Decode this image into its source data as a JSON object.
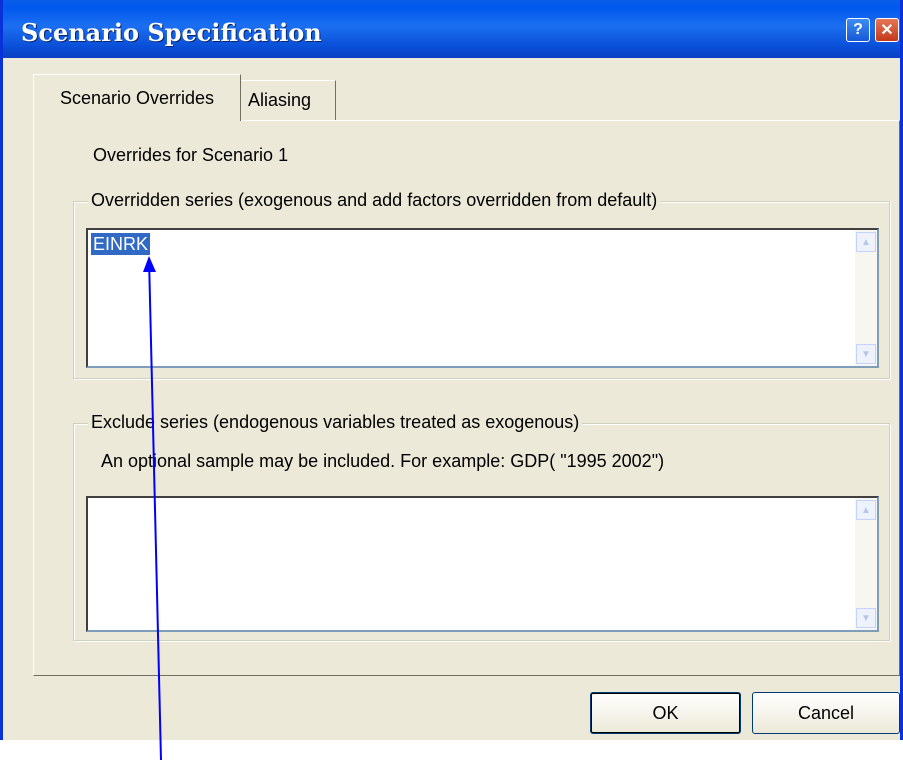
{
  "window": {
    "title": "Scenario Specification",
    "help_glyph": "?",
    "close_glyph": "✕"
  },
  "tabs": [
    {
      "label": "Scenario Overrides",
      "active": true
    },
    {
      "label": "Aliasing",
      "active": false
    }
  ],
  "panel": {
    "heading": "Overrides for Scenario 1",
    "overridden_group": {
      "legend": "Overridden series (exogenous and add factors overridden from default)",
      "items": [
        "EINRK"
      ],
      "selected_item": "EINRK"
    },
    "exclude_group": {
      "legend": "Exclude series (endogenous variables treated as exogenous)",
      "hint": "An optional sample may be included. For example: GDP( \"1995  2002\")",
      "items": []
    }
  },
  "buttons": {
    "ok": "OK",
    "cancel": "Cancel"
  },
  "colors": {
    "titlebar": "#0a4fd8",
    "face": "#ece9d8",
    "selection": "#316ac5",
    "annotation_arrow": "#0000ff"
  },
  "icons": {
    "help": "help-icon",
    "close": "close-icon",
    "scroll_up": "scroll-up-icon",
    "scroll_down": "scroll-down-icon"
  }
}
